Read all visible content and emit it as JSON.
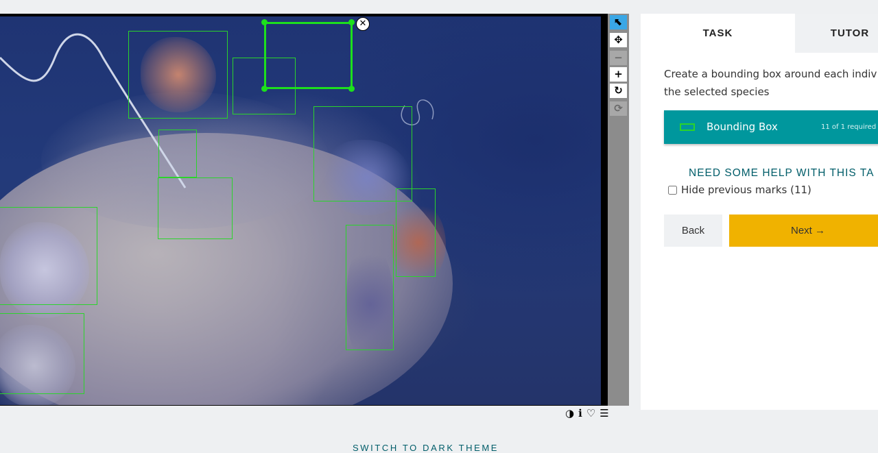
{
  "tabs": {
    "task": "TASK",
    "tutorial": "TUTOR"
  },
  "task": {
    "instruction_line1": "Create a bounding box around each indiv",
    "instruction_line2": "the selected species",
    "tool": {
      "label": "Bounding Box",
      "count": "11 of 1 required",
      "color": "#2bd42b"
    },
    "help_link": "NEED SOME HELP WITH THIS TA",
    "hide_marks_label": "Hide previous marks (11)"
  },
  "buttons": {
    "back": "Back",
    "next": "Next →"
  },
  "toolbar": {
    "tools": [
      {
        "name": "pointer-icon",
        "glyph": "⬉",
        "state": "active"
      },
      {
        "name": "move-icon",
        "glyph": "✥",
        "state": "normal"
      },
      {
        "name": "zoom-out-icon",
        "glyph": "−",
        "state": "disabled"
      },
      {
        "name": "zoom-in-icon",
        "glyph": "+",
        "state": "normal"
      },
      {
        "name": "rotate-icon",
        "glyph": "↻",
        "state": "normal"
      },
      {
        "name": "reset-icon",
        "glyph": "⟳",
        "state": "disabled"
      }
    ]
  },
  "meta_icons": [
    "contrast-icon",
    "info-icon",
    "heart-icon",
    "list-icon"
  ],
  "colors": {
    "accent": "#00979d",
    "next": "#f0b200",
    "link": "#005d69",
    "mark": "#2bd42b"
  },
  "footer": {
    "theme_link": "SWITCH TO DARK THEME"
  }
}
